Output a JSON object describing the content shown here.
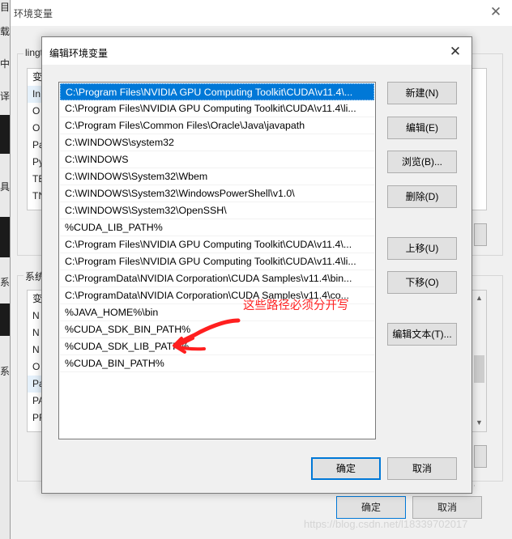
{
  "background": {
    "chars": [
      "目",
      "载",
      "中",
      "译",
      "具",
      "系",
      "系"
    ]
  },
  "parent_dialog": {
    "title": "环境变量",
    "user_section_label": "lingt",
    "user_vars_peek": [
      "变",
      "In",
      "O",
      "O",
      "Pa",
      "Py",
      "TE",
      "TN"
    ],
    "system_section_label": "系统",
    "system_vars_peek": [
      "变",
      "N",
      "N",
      "N",
      "O",
      "Pa",
      "PA",
      "PF"
    ],
    "ok_label": "确定",
    "cancel_label": "取消",
    "watermark": "https://blog.csdn.net/l18339702017"
  },
  "dialog": {
    "title": "编辑环境变量",
    "paths": [
      "C:\\Program Files\\NVIDIA GPU Computing Toolkit\\CUDA\\v11.4\\...",
      "C:\\Program Files\\NVIDIA GPU Computing Toolkit\\CUDA\\v11.4\\li...",
      "C:\\Program Files\\Common Files\\Oracle\\Java\\javapath",
      "C:\\WINDOWS\\system32",
      "C:\\WINDOWS",
      "C:\\WINDOWS\\System32\\Wbem",
      "C:\\WINDOWS\\System32\\WindowsPowerShell\\v1.0\\",
      "C:\\WINDOWS\\System32\\OpenSSH\\",
      "%CUDA_LIB_PATH%",
      "C:\\Program Files\\NVIDIA GPU Computing Toolkit\\CUDA\\v11.4\\...",
      "C:\\Program Files\\NVIDIA GPU Computing Toolkit\\CUDA\\v11.4\\li...",
      "C:\\ProgramData\\NVIDIA Corporation\\CUDA Samples\\v11.4\\bin...",
      "C:\\ProgramData\\NVIDIA Corporation\\CUDA Samples\\v11.4\\co...",
      "%JAVA_HOME%\\bin",
      "%CUDA_SDK_BIN_PATH%",
      "%CUDA_SDK_LIB_PATH%",
      "%CUDA_BIN_PATH%"
    ],
    "selected_index": 0,
    "buttons": {
      "new": "新建(N)",
      "edit": "编辑(E)",
      "browse": "浏览(B)...",
      "delete": "删除(D)",
      "move_up": "上移(U)",
      "move_down": "下移(O)",
      "edit_text": "编辑文本(T)...",
      "ok": "确定",
      "cancel": "取消"
    },
    "annotation": "这些路径必须分开写",
    "annotation_color": "#ff1f1f",
    "accent_color": "#0078d7"
  }
}
